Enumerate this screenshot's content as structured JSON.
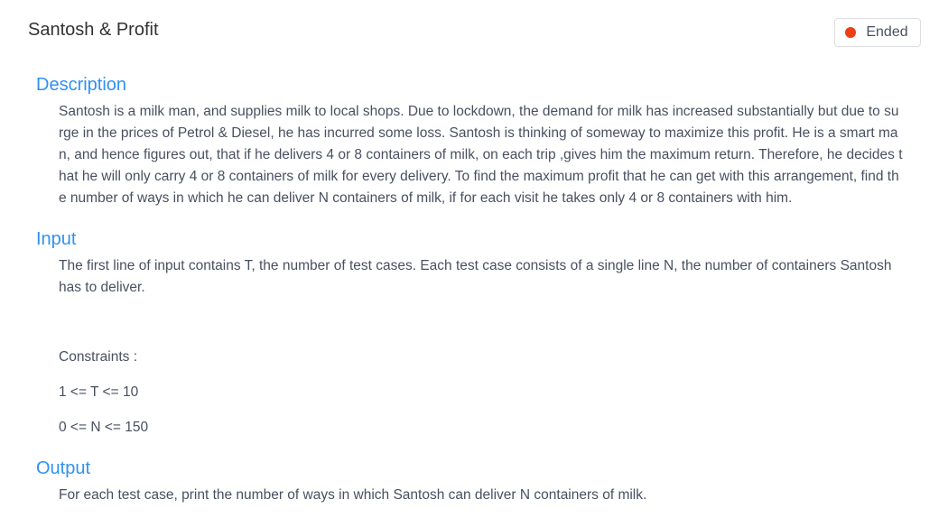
{
  "header": {
    "title": "Santosh & Profit",
    "status_label": "Ended",
    "status_color": "#ed3f14"
  },
  "theme": {
    "heading_color": "#3091f2"
  },
  "sections": {
    "description": {
      "heading": "Description",
      "text": "Santosh is a milk man, and supplies milk to local shops. Due to lockdown, the demand for milk has increased substantially but due to surge in the prices of Petrol & Diesel, he has incurred some loss. Santosh is thinking of someway to maximize this profit. He is a smart man, and hence figures out, that  if he delivers  4 or 8 containers of milk, on each trip ,gives him the maximum return. Therefore, he decides that he will only carry 4 or 8 containers of milk for every delivery. To find the maximum profit that he can get with this arrangement, find the number of ways in which he can deliver N containers of milk, if for each visit he takes only 4 or 8 containers with him."
    },
    "input": {
      "heading": "Input",
      "text": "The first line of input contains T, the number of test cases. Each test case consists of a single line N, the number of containers Santosh has to deliver.",
      "constraints_label": "Constraints :",
      "constraint_1": "1 <= T <= 10",
      "constraint_2": "0 <= N <= 150"
    },
    "output": {
      "heading": "Output",
      "text": "For each test case, print the number of ways in which Santosh can deliver N containers of milk."
    }
  }
}
